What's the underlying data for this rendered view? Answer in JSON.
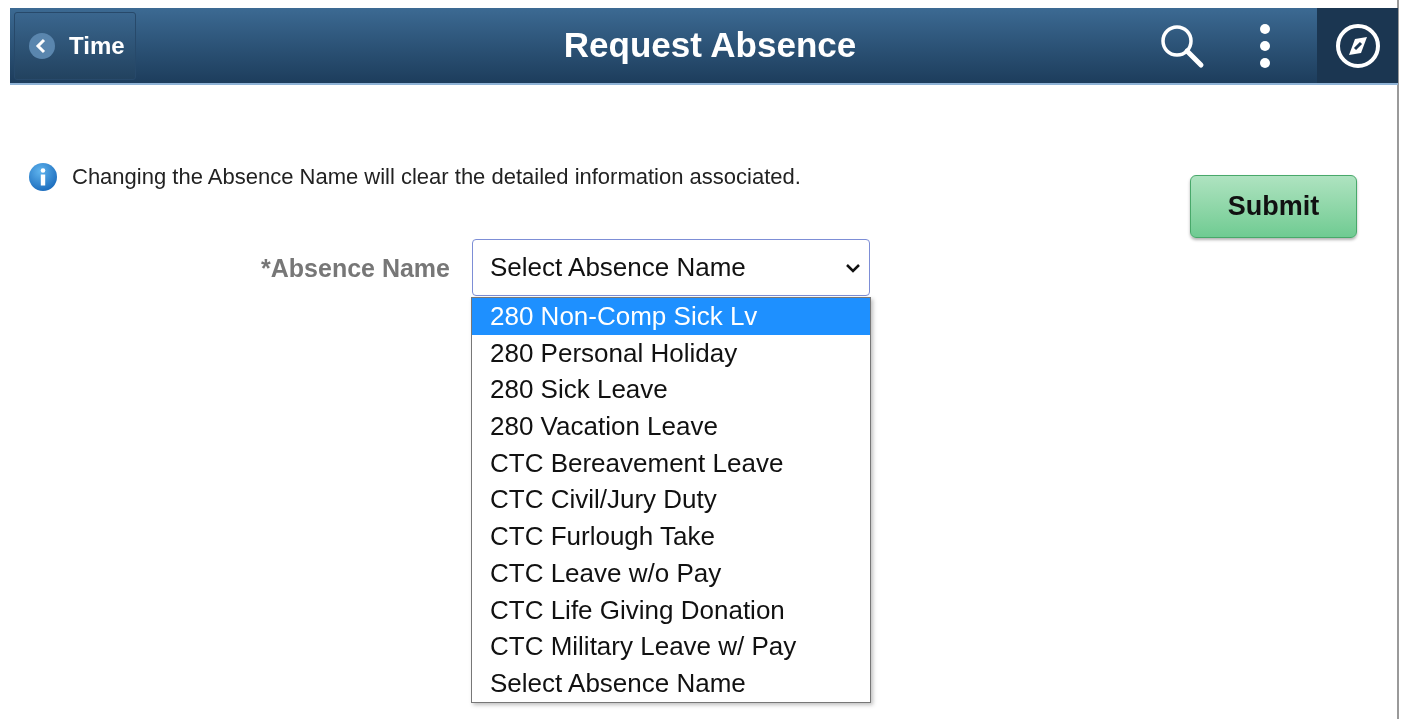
{
  "header": {
    "back_label": "Time",
    "title": "Request Absence"
  },
  "info_message": "Changing the Absence Name will clear the detailed information associated.",
  "submit_label": "Submit",
  "absence_name": {
    "label": "*Absence Name",
    "value": "Select Absence Name",
    "expanded": true,
    "options": [
      {
        "label": "280 Non-Comp Sick Lv",
        "highlighted": true
      },
      {
        "label": "280 Personal Holiday",
        "highlighted": false
      },
      {
        "label": "280 Sick Leave",
        "highlighted": false
      },
      {
        "label": "280 Vacation Leave",
        "highlighted": false
      },
      {
        "label": "CTC Bereavement Leave",
        "highlighted": false
      },
      {
        "label": "CTC Civil/Jury Duty",
        "highlighted": false
      },
      {
        "label": "CTC Furlough Take",
        "highlighted": false
      },
      {
        "label": "CTC Leave w/o Pay",
        "highlighted": false
      },
      {
        "label": "CTC Life Giving Donation",
        "highlighted": false
      },
      {
        "label": "CTC Military Leave w/ Pay",
        "highlighted": false
      },
      {
        "label": "Select Absence Name",
        "highlighted": false
      }
    ]
  }
}
